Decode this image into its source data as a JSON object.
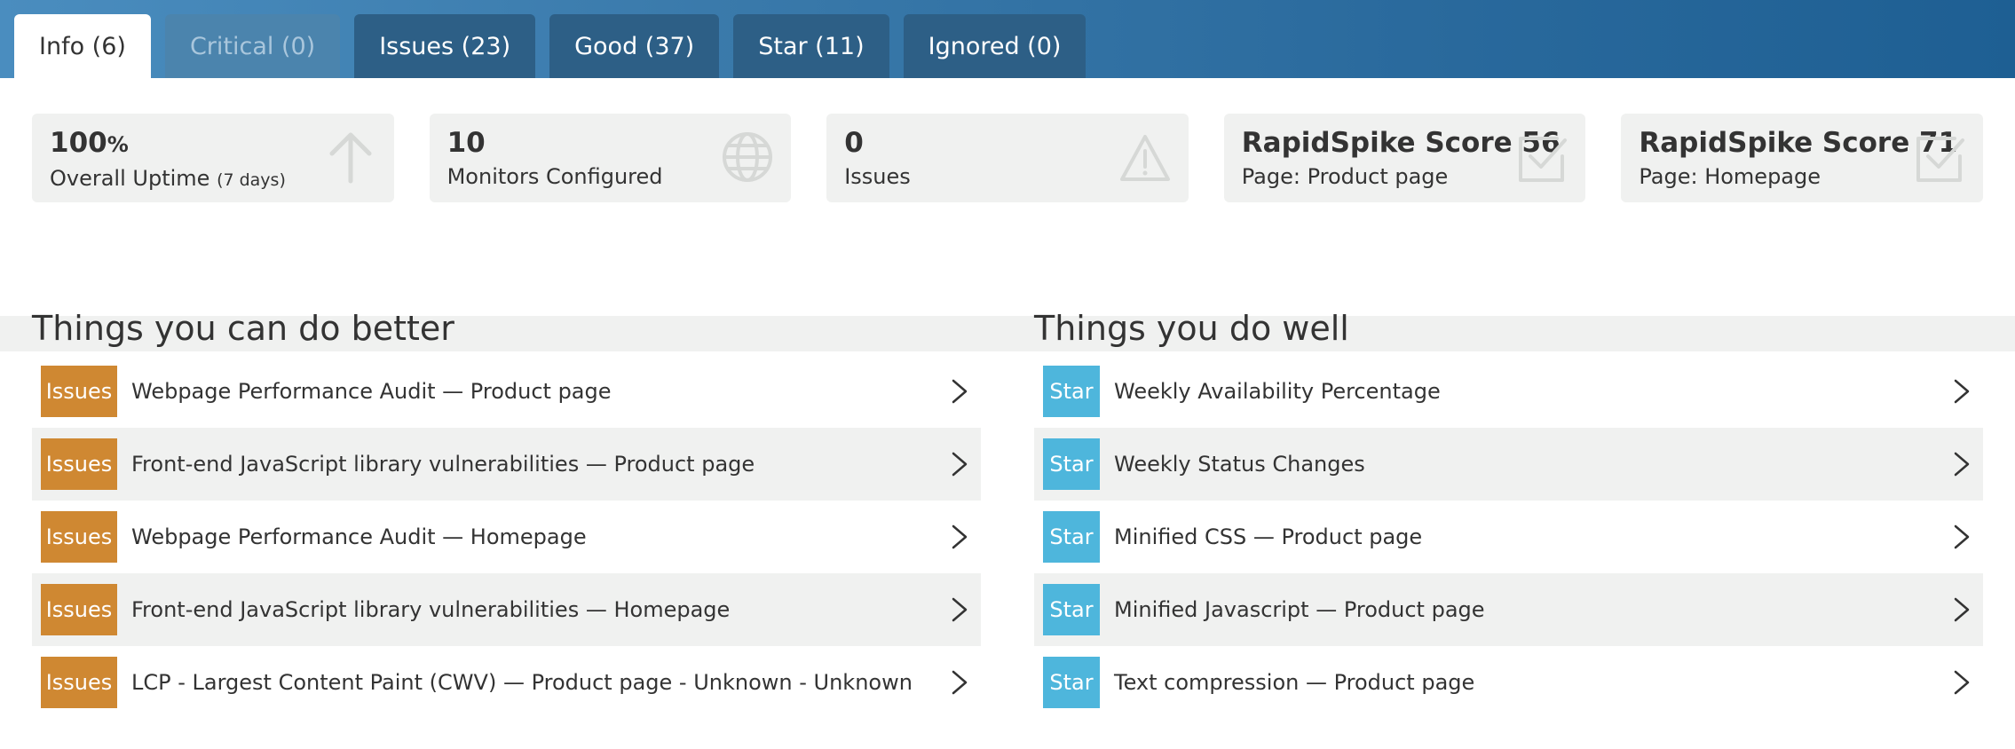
{
  "tabs": [
    {
      "label": "Info (6)",
      "state": "active"
    },
    {
      "label": "Critical (0)",
      "state": "muted"
    },
    {
      "label": "Issues (23)",
      "state": "normal"
    },
    {
      "label": "Good (37)",
      "state": "normal"
    },
    {
      "label": "Star (11)",
      "state": "normal"
    },
    {
      "label": "Ignored (0)",
      "state": "normal"
    }
  ],
  "stats": [
    {
      "value": "100",
      "unit": "%",
      "label": "Overall Uptime",
      "label_small": "(7 days)",
      "icon": "arrow-up-icon"
    },
    {
      "value": "10",
      "label": "Monitors Configured",
      "icon": "globe-icon"
    },
    {
      "value": "0",
      "label": "Issues",
      "icon": "warning-icon"
    },
    {
      "value": "RapidSpike Score 56",
      "label": "Page: Product page",
      "icon": "checkbox-icon"
    },
    {
      "value": "RapidSpike Score 71",
      "label": "Page: Homepage",
      "icon": "checkbox-icon"
    }
  ],
  "better": {
    "title": "Things you can do better",
    "badge": "Issues",
    "items": [
      "Webpage Performance Audit — Product page",
      "Front-end JavaScript library vulnerabilities — Product page",
      "Webpage Performance Audit — Homepage",
      "Front-end JavaScript library vulnerabilities — Homepage",
      "LCP - Largest Content Paint (CWV) — Product page - Unknown - Unknown"
    ]
  },
  "well": {
    "title": "Things you do well",
    "badge": "Star",
    "items": [
      "Weekly Availability Percentage",
      "Weekly Status Changes",
      "Minified CSS — Product page",
      "Minified Javascript — Product page",
      "Text compression — Product page"
    ]
  },
  "colors": {
    "issue_badge": "#cf8832",
    "star_badge": "#4eb6dc",
    "header_start": "#4a8dbf",
    "header_end": "#1e5f93",
    "panel_bg": "#f0f1f0"
  }
}
